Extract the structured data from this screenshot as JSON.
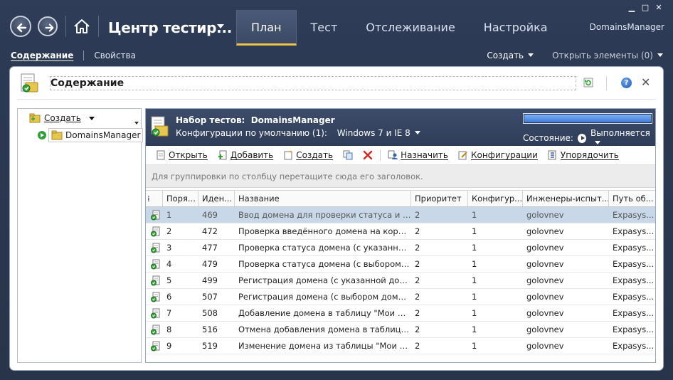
{
  "window": {
    "minimize": "▁",
    "maximize": "□",
    "close": "✕"
  },
  "header": {
    "app_title": "Центр тестир...",
    "tabs": [
      {
        "label": "План",
        "active": true
      },
      {
        "label": "Тест",
        "active": false
      },
      {
        "label": "Отслеживание",
        "active": false
      },
      {
        "label": "Настройка",
        "active": false
      }
    ],
    "user": "DomainsManager"
  },
  "subnav": {
    "left": [
      {
        "label": "Содержание",
        "active": true
      },
      {
        "label": "Свойства",
        "active": false
      }
    ],
    "create": "Создать",
    "open_items": "Открыть элементы (0)"
  },
  "panel": {
    "title": "Содержание",
    "help": "?",
    "close": "✕"
  },
  "tree": {
    "create": "Создать",
    "node": "DomainsManager"
  },
  "suite": {
    "label": "Набор тестов:",
    "name": "DomainsManager",
    "config_label": "Конфигурации по умолчанию (1):",
    "config_value": "Windows 7 и IE 8",
    "state_label": "Состояние:",
    "state_value": "Выполняется",
    "progress": 1.0
  },
  "toolbar": {
    "open": "Открыть",
    "add": "Добавить",
    "create": "Создать",
    "assign": "Назначить",
    "configurations": "Конфигурации",
    "order": "Упорядочить"
  },
  "grid": {
    "group_hint": "Для группировки по столбцу перетащите сюда его заголовок.",
    "columns": [
      "Поря...",
      "Иден...",
      "Название",
      "Приоритет",
      "Конфигур...",
      "Инженеры-испыт...",
      "Путь об..."
    ],
    "rows": [
      {
        "order": "1",
        "id": "469",
        "title": "Ввод домена для проверки статуса и реги...",
        "priority": "2",
        "config": "1",
        "tester": "golovnev",
        "path": "Expasys..."
      },
      {
        "order": "2",
        "id": "472",
        "title": "Проверка введённого домена на коррект...",
        "priority": "2",
        "config": "1",
        "tester": "golovnev",
        "path": "Expasys..."
      },
      {
        "order": "3",
        "id": "477",
        "title": "Проверка статуса домена (с указанной до...",
        "priority": "2",
        "config": "1",
        "tester": "golovnev",
        "path": "Expasys..."
      },
      {
        "order": "4",
        "id": "479",
        "title": "Проверка статуса домена (с выбором дом...",
        "priority": "2",
        "config": "1",
        "tester": "golovnev",
        "path": "Expasys..."
      },
      {
        "order": "5",
        "id": "499",
        "title": "Регистрация домена (с указанной доменн...",
        "priority": "2",
        "config": "1",
        "tester": "golovnev",
        "path": "Expasys..."
      },
      {
        "order": "6",
        "id": "507",
        "title": "Регистрация домена (с выбором доменны...",
        "priority": "2",
        "config": "1",
        "tester": "golovnev",
        "path": "Expasys..."
      },
      {
        "order": "7",
        "id": "508",
        "title": "Добавление домена в таблицу \"Мои доме...",
        "priority": "2",
        "config": "1",
        "tester": "golovnev",
        "path": "Expasys..."
      },
      {
        "order": "8",
        "id": "516",
        "title": "Отмена добавления домена в таблицу \"М...",
        "priority": "2",
        "config": "1",
        "tester": "golovnev",
        "path": "Expasys..."
      },
      {
        "order": "9",
        "id": "519",
        "title": "Изменение домена из таблицы \"Мои дом...",
        "priority": "2",
        "config": "1",
        "tester": "golovnev",
        "path": "Expasys..."
      }
    ]
  }
}
